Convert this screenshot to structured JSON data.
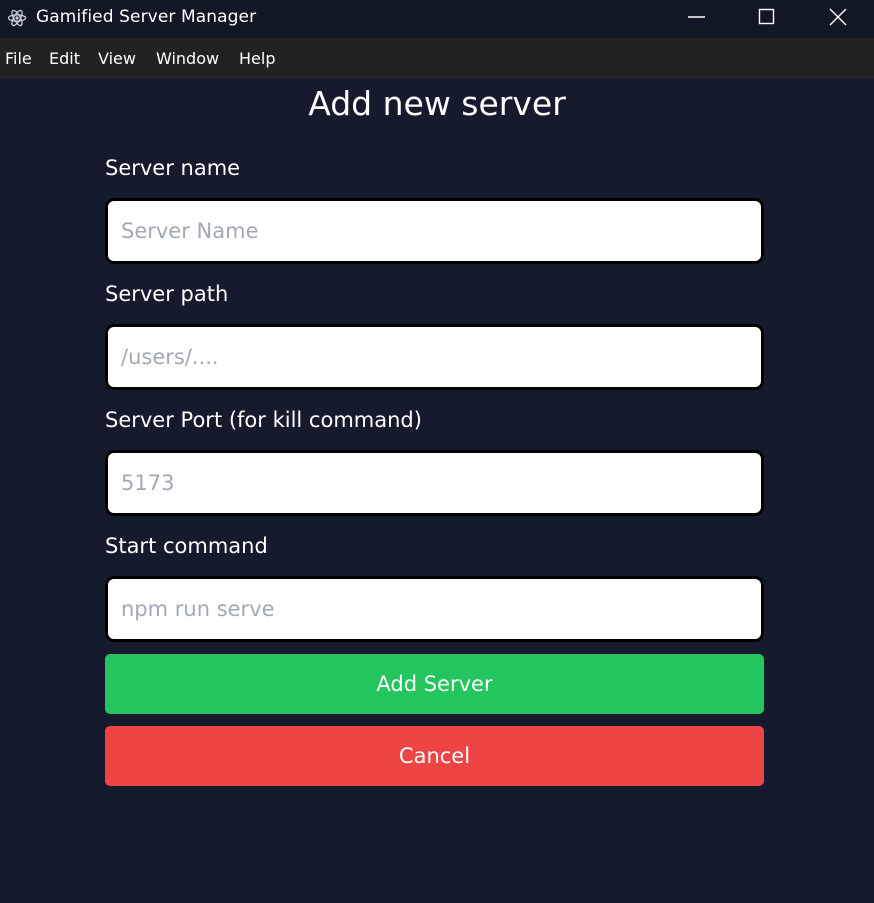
{
  "window": {
    "title": "Gamified Server Manager",
    "icon": "electron-atom-icon",
    "controls": [
      "minimize-icon",
      "maximize-icon",
      "close-icon"
    ]
  },
  "menu": {
    "items": [
      "File",
      "Edit",
      "View",
      "Window",
      "Help"
    ]
  },
  "form": {
    "title": "Add new server",
    "fields": [
      {
        "label": "Server name",
        "value": "",
        "placeholder": "Server Name"
      },
      {
        "label": "Server path",
        "value": "",
        "placeholder": "/users/...."
      },
      {
        "label": "Server Port (for kill command)",
        "value": "",
        "placeholder": "5173"
      },
      {
        "label": "Start command",
        "value": "",
        "placeholder": "npm run serve"
      }
    ],
    "submit_label": "Add Server",
    "cancel_label": "Cancel"
  },
  "colors": {
    "background": "#151a2c",
    "titlebar": "#121726",
    "menubar": "#222222",
    "submit": "#22c55e",
    "cancel": "#ef4444"
  }
}
